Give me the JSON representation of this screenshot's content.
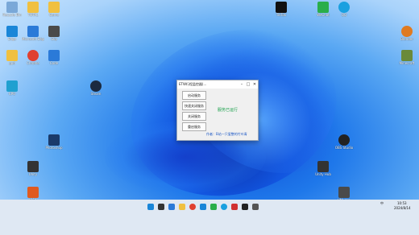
{
  "window": {
    "title": "ETW行程监控器(...",
    "buttons": [
      "启动服务",
      "快速关闭服务",
      "关闭服务",
      "重启服务"
    ],
    "status": "服务已运行",
    "author": "作者：B站一只爱整的竹叶青"
  },
  "desktop_icons_left": [
    {
      "label": "Recycle Bin",
      "color": "#7aa8d8"
    },
    {
      "label": "TOTAL",
      "color": "#f0c040"
    },
    {
      "label": "Game",
      "color": "#f0c040"
    },
    {
      "label": "Edge",
      "color": "#1a86d8"
    },
    {
      "label": "Microsoft Edge",
      "color": "#2b7ad8"
    },
    {
      "label": "Glip",
      "color": "#4a4a4a"
    },
    {
      "label": "gpd",
      "color": "#f0c040"
    },
    {
      "label": "Chrome",
      "color": "#e04030"
    },
    {
      "label": "Code",
      "color": "#2b7ad8"
    },
    {
      "label": "CPU",
      "color": "#20a0d0"
    },
    {
      "label": "Photoshop",
      "color": "#1a3a6a"
    },
    {
      "label": "Unity",
      "color": "#333"
    },
    {
      "label": "Steam",
      "color": "#1b2a40"
    },
    {
      "label": "IDEA",
      "color": "#e05a20"
    }
  ],
  "desktop_icons_right": [
    {
      "label": "TikTok",
      "color": "#111"
    },
    {
      "label": "QQ",
      "color": "#1aa0e0"
    },
    {
      "label": "WeChat",
      "color": "#2aae4a"
    },
    {
      "label": "OBS Studio",
      "color": "#222"
    },
    {
      "label": "Unity Hub",
      "color": "#333"
    },
    {
      "label": "VMware",
      "color": "#4a4a4a"
    },
    {
      "label": "Blender",
      "color": "#e07a20"
    },
    {
      "label": "Minecraft",
      "color": "#6a8a3a"
    }
  ],
  "taskbar": {
    "time": "10:53",
    "date": "2024/8/14",
    "lang": "中"
  }
}
